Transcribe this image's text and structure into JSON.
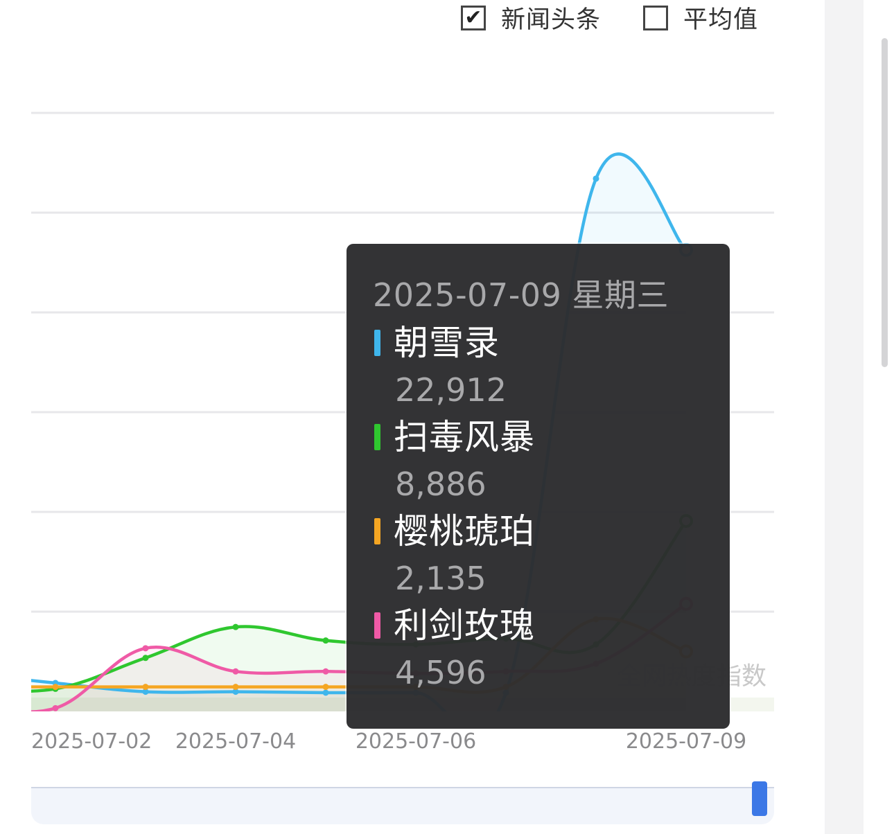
{
  "legend_toggles": {
    "headlines": {
      "label": "新闻头条",
      "checked": true,
      "check_glyph": "✔"
    },
    "average": {
      "label": "平均值",
      "checked": false
    }
  },
  "watermark": "全网热度指数",
  "tooltip": {
    "date": "2025-07-09 星期三",
    "items": [
      {
        "name": "朝雪录",
        "value": "22,912",
        "color": "#3fb6ec"
      },
      {
        "name": "扫毒风暴",
        "value": "8,886",
        "color": "#2fc72f"
      },
      {
        "name": "樱桃琥珀",
        "value": "2,135",
        "color": "#f5a623"
      },
      {
        "name": "利剑玫瑰",
        "value": "4,596",
        "color": "#ef5aa6"
      }
    ]
  },
  "chart_data": {
    "type": "line",
    "x": [
      "2025-07-01",
      "2025-07-02",
      "2025-07-03",
      "2025-07-04",
      "2025-07-05",
      "2025-07-06",
      "2025-07-07",
      "2025-07-08",
      "2025-07-09"
    ],
    "x_tick_labels": [
      "2025-07-02",
      "2025-07-04",
      "2025-07-06",
      "2025-07-09"
    ],
    "ylim": [
      0,
      30000
    ],
    "grid": true,
    "series": [
      {
        "name": "朝雪录",
        "color": "#3fb6ec",
        "values": [
          1000,
          500,
          50,
          50,
          0,
          0,
          0,
          26600,
          22912
        ]
      },
      {
        "name": "扫毒风暴",
        "values": [
          200,
          200,
          1800,
          3400,
          2700,
          2500,
          2800,
          2500,
          8886
        ],
        "color": "#2fc72f"
      },
      {
        "name": "樱桃琥珀",
        "values": [
          300,
          300,
          300,
          300,
          300,
          300,
          300,
          3800,
          2135
        ],
        "color": "#f5a623"
      },
      {
        "name": "利剑玫瑰",
        "values": [
          -600,
          -800,
          2300,
          1100,
          1100,
          1000,
          1100,
          1500,
          4596
        ],
        "color": "#ef5aa6"
      }
    ]
  }
}
